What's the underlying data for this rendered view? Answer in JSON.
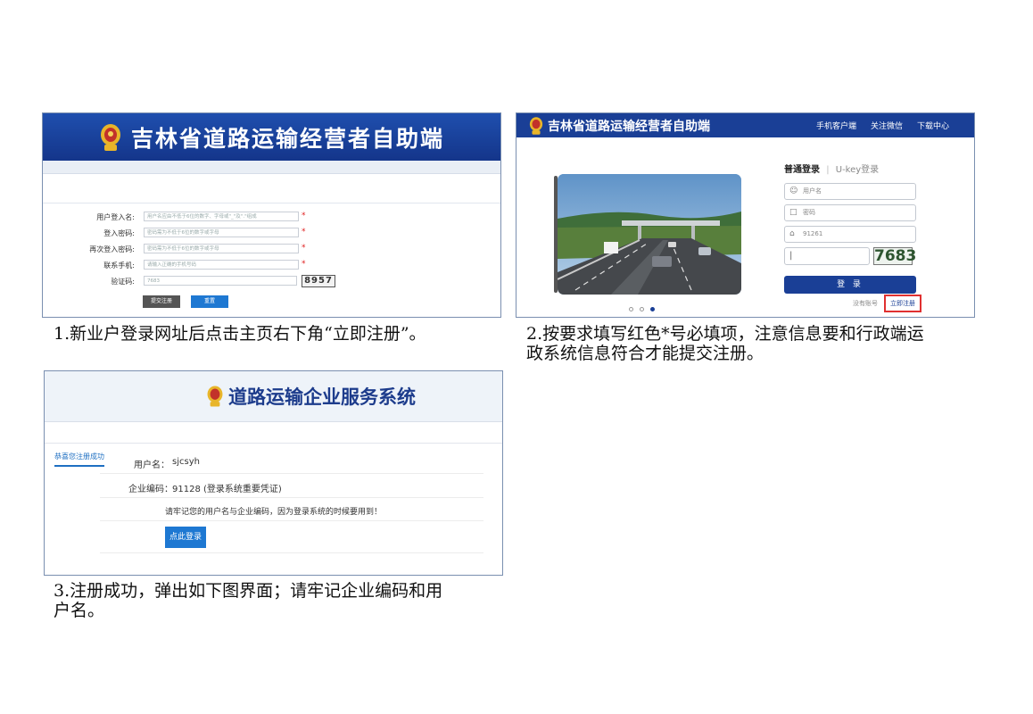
{
  "shot1": {
    "title": "吉林省道路运输经营者自助端",
    "fields": [
      {
        "label": "用户登入名:",
        "placeholder": "用户名应由不低于6位的数字、字母或\"_\"及\".\"组成",
        "required": true
      },
      {
        "label": "登入密码:",
        "placeholder": "密码需为不低于6位的数字或字母",
        "required": true
      },
      {
        "label": "再次登入密码:",
        "placeholder": "密码需为不低于6位的数字或字母",
        "required": true
      },
      {
        "label": "联系手机:",
        "placeholder": "请输入正确的手机号码",
        "required": true
      },
      {
        "label": "验证码:",
        "placeholder": "7683",
        "required": false
      }
    ],
    "required_mark": "*",
    "captcha": "8957",
    "submit_label": "提交注册",
    "reset_label": "重置"
  },
  "shot2": {
    "title": "吉林省道路运输经营者自助端",
    "nav": [
      "手机客户端",
      "关注微信",
      "下载中心"
    ],
    "tab_normal": "普通登录",
    "tab_separator": "|",
    "tab_ukey": "U-key登录",
    "username_placeholder": "用户名",
    "password_placeholder": "密码",
    "company_code": "91261",
    "code_input": "|",
    "captcha": "7683",
    "login_label": "登 录",
    "no_account": "没有账号",
    "register_label": "立即注册",
    "icons": {
      "user": "user-icon",
      "lock": "lock-icon",
      "home": "home-icon"
    }
  },
  "shot3": {
    "title": "道路运输企业服务系统",
    "side_tab": "恭喜您注册成功",
    "username_label": "用户名：",
    "username_value": "sjcsyh",
    "code_label": "企业编码：",
    "code_value": "91128 (登录系统重要凭证)",
    "notice": "请牢记您的用户名与企业编码，因为登录系统的时候要用到！",
    "login_button": "点此登录"
  },
  "captions": {
    "c1": "1.新业户登录网址后点击主页右下角“立即注册”。",
    "c2_line1": "2.按要求填写红色*号必填项，注意信息要和行政端运",
    "c2_line2": "政系统信息符合才能提交注册。",
    "c3_line1": "3.注册成功，弹出如下图界面；请牢记企业编码和用",
    "c3_line2": "户名。"
  }
}
